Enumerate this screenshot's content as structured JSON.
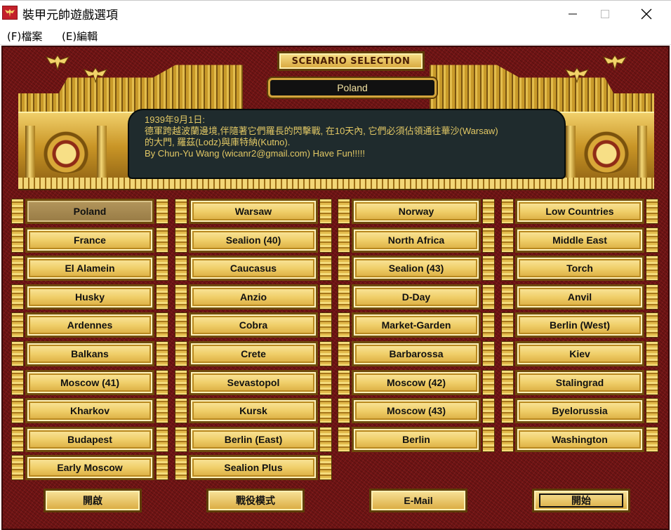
{
  "window": {
    "title": "裝甲元帥遊戲選項",
    "icon": "eagle-icon",
    "controls": [
      "minimize-icon",
      "maximize-icon",
      "close-icon"
    ]
  },
  "menu": {
    "file": "(F)檔案",
    "edit": "(E)編輯"
  },
  "header": {
    "banner": "SCENARIO SELECTION",
    "current_scenario": "Poland"
  },
  "description": {
    "lines": [
      "1939年9月1日:",
      "德軍跨越波蘭邊境,伴隨著它們羅長的閃擊戰, 在10天內, 它們必須佔領通往華沙(Warsaw)",
      "的大門, 羅茲(Lodz)與庫特納(Kutno).",
      "By Chun-Yu Wang (wicanr2@gmail.com) Have Fun!!!!!"
    ]
  },
  "scenarios": {
    "columns": [
      [
        "Poland",
        "France",
        "El Alamein",
        "Husky",
        "Ardennes",
        "Balkans",
        "Moscow (41)",
        "Kharkov",
        "Budapest",
        "Early Moscow"
      ],
      [
        "Warsaw",
        "Sealion (40)",
        "Caucasus",
        "Anzio",
        "Cobra",
        "Crete",
        "Sevastopol",
        "Kursk",
        "Berlin (East)",
        "Sealion Plus"
      ],
      [
        "Norway",
        "North Africa",
        "Sealion (43)",
        "D-Day",
        "Market-Garden",
        "Barbarossa",
        "Moscow (42)",
        "Moscow (43)",
        "Berlin"
      ],
      [
        "Low Countries",
        "Middle East",
        "Torch",
        "Anvil",
        "Berlin (West)",
        "Kiev",
        "Stalingrad",
        "Byelorussia",
        "Washington"
      ]
    ],
    "selected": "Poland"
  },
  "actions": {
    "open": "開啟",
    "campaign": "戰役模式",
    "email": "E-Mail",
    "start": "開始"
  },
  "colors": {
    "background": "#6f1414",
    "gold": "#f0cf6a",
    "panel": "#1f2b2d",
    "panel_text": "#e2c865"
  }
}
